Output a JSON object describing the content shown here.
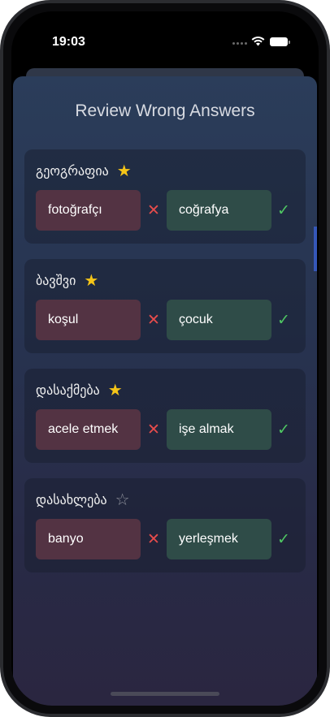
{
  "status_bar": {
    "time": "19:03"
  },
  "screen": {
    "title": "Review Wrong Answers"
  },
  "colors": {
    "wrong_bg": "#533343",
    "correct_bg": "#2f4c48",
    "wrong_mark": "#e74c4c",
    "correct_mark": "#4fc763",
    "star_filled": "#f5c518",
    "star_empty": "#8c8f9a"
  },
  "items": [
    {
      "word": "გეოგრაფია",
      "starred": true,
      "star_glyph": "★",
      "wrong_answer": "fotoğrafçı",
      "wrong_mark": "✕",
      "correct_answer": "coğrafya",
      "correct_mark": "✓"
    },
    {
      "word": "ბავშვი",
      "starred": true,
      "star_glyph": "★",
      "wrong_answer": "koşul",
      "wrong_mark": "✕",
      "correct_answer": "çocuk",
      "correct_mark": "✓"
    },
    {
      "word": "დასაქმება",
      "starred": true,
      "star_glyph": "★",
      "wrong_answer": "acele etmek",
      "wrong_mark": "✕",
      "correct_answer": "işe almak",
      "correct_mark": "✓"
    },
    {
      "word": "დასახლება",
      "starred": false,
      "star_glyph": "☆",
      "wrong_answer": "banyo",
      "wrong_mark": "✕",
      "correct_answer": "yerleşmek",
      "correct_mark": "✓"
    }
  ]
}
